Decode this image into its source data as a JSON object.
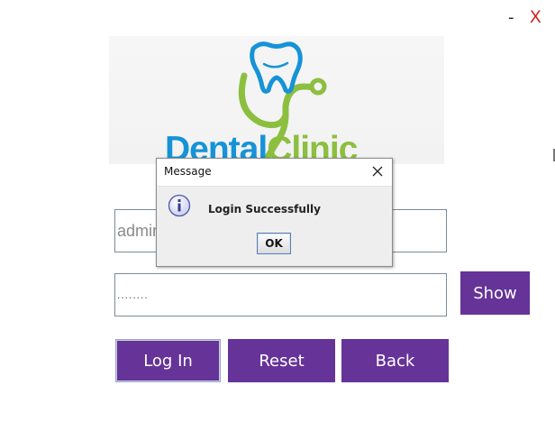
{
  "window": {
    "minimize_label": "-",
    "close_label": "X"
  },
  "logo": {
    "brand_part1": "Dental",
    "brand_part2": "Clinic",
    "colors": {
      "blue": "#1693d6",
      "green": "#8cbf3f"
    }
  },
  "form": {
    "username_value": "admin",
    "password_value": "........",
    "show_label": "Show",
    "login_label": "Log In",
    "reset_label": "Reset",
    "back_label": "Back"
  },
  "dialog": {
    "title": "Message",
    "message": "Login Successfully",
    "ok_label": "OK",
    "icon": "info-icon"
  },
  "colors": {
    "button_purple": "#663399",
    "close_red": "#d11a1a"
  }
}
